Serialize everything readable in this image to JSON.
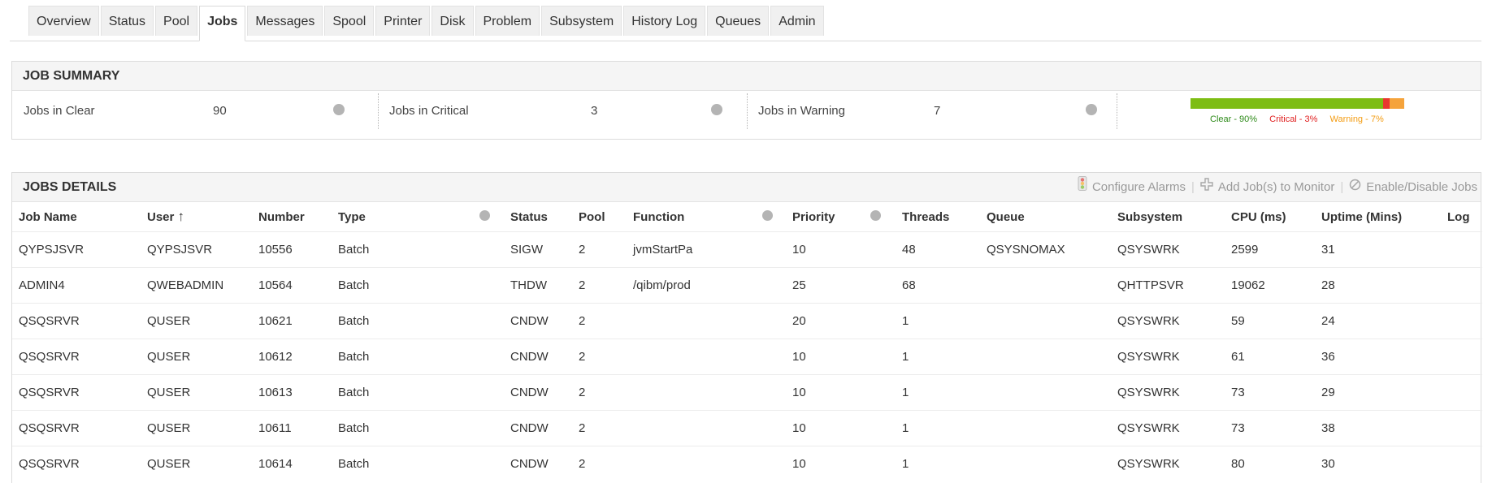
{
  "tabs": [
    {
      "label": "Overview",
      "active": false
    },
    {
      "label": "Status",
      "active": false
    },
    {
      "label": "Pool",
      "active": false
    },
    {
      "label": "Jobs",
      "active": true
    },
    {
      "label": "Messages",
      "active": false
    },
    {
      "label": "Spool",
      "active": false
    },
    {
      "label": "Printer",
      "active": false
    },
    {
      "label": "Disk",
      "active": false
    },
    {
      "label": "Problem",
      "active": false
    },
    {
      "label": "Subsystem",
      "active": false
    },
    {
      "label": "History Log",
      "active": false
    },
    {
      "label": "Queues",
      "active": false
    },
    {
      "label": "Admin",
      "active": false
    }
  ],
  "summary": {
    "title": "JOB SUMMARY",
    "clear": {
      "label": "Jobs in Clear",
      "value": "90"
    },
    "critical": {
      "label": "Jobs in Critical",
      "value": "3"
    },
    "warning": {
      "label": "Jobs in Warning",
      "value": "7"
    },
    "health": {
      "clear_pct": 90,
      "critical_pct": 3,
      "warning_pct": 7,
      "clear_label": "Clear - 90%",
      "critical_label": "Critical - 3%",
      "warning_label": "Warning - 7%",
      "colors": {
        "clear": "#7dbd13",
        "critical": "#e8382e",
        "warning": "#f5a33b"
      },
      "legend_colors": {
        "clear": "#2e8b1a",
        "critical": "#e02020",
        "warning": "#f39c12"
      }
    }
  },
  "details": {
    "title": "JOBS DETAILS",
    "actions": {
      "configure": "Configure Alarms",
      "add": "Add Job(s) to Monitor",
      "enable": "Enable/Disable Jobs"
    },
    "columns": {
      "job_name": "Job Name",
      "user": "User",
      "user_sort": "↑",
      "number": "Number",
      "type": "Type",
      "status": "Status",
      "pool": "Pool",
      "function": "Function",
      "priority": "Priority",
      "threads": "Threads",
      "queue": "Queue",
      "subsystem": "Subsystem",
      "cpu": "CPU (ms)",
      "uptime": "Uptime (Mins)",
      "log": "Log"
    },
    "rows": [
      {
        "job_name": "QYPSJSVR",
        "user": "QYPSJSVR",
        "number": "10556",
        "type": "Batch",
        "status": "SIGW",
        "pool": "2",
        "function": "jvmStartPa",
        "priority": "10",
        "threads": "48",
        "queue": "QSYSNOMAX",
        "subsystem": "QSYSWRK",
        "cpu": "2599",
        "uptime": "31",
        "log": ""
      },
      {
        "job_name": "ADMIN4",
        "user": "QWEBADMIN",
        "number": "10564",
        "type": "Batch",
        "status": "THDW",
        "pool": "2",
        "function": "/qibm/prod",
        "priority": "25",
        "threads": "68",
        "queue": "",
        "subsystem": "QHTTPSVR",
        "cpu": "19062",
        "uptime": "28",
        "log": ""
      },
      {
        "job_name": "QSQSRVR",
        "user": "QUSER",
        "number": "10621",
        "type": "Batch",
        "status": "CNDW",
        "pool": "2",
        "function": "",
        "priority": "20",
        "threads": "1",
        "queue": "",
        "subsystem": "QSYSWRK",
        "cpu": "59",
        "uptime": "24",
        "log": ""
      },
      {
        "job_name": "QSQSRVR",
        "user": "QUSER",
        "number": "10612",
        "type": "Batch",
        "status": "CNDW",
        "pool": "2",
        "function": "",
        "priority": "10",
        "threads": "1",
        "queue": "",
        "subsystem": "QSYSWRK",
        "cpu": "61",
        "uptime": "36",
        "log": ""
      },
      {
        "job_name": "QSQSRVR",
        "user": "QUSER",
        "number": "10613",
        "type": "Batch",
        "status": "CNDW",
        "pool": "2",
        "function": "",
        "priority": "10",
        "threads": "1",
        "queue": "",
        "subsystem": "QSYSWRK",
        "cpu": "73",
        "uptime": "29",
        "log": ""
      },
      {
        "job_name": "QSQSRVR",
        "user": "QUSER",
        "number": "10611",
        "type": "Batch",
        "status": "CNDW",
        "pool": "2",
        "function": "",
        "priority": "10",
        "threads": "1",
        "queue": "",
        "subsystem": "QSYSWRK",
        "cpu": "73",
        "uptime": "38",
        "log": ""
      },
      {
        "job_name": "QSQSRVR",
        "user": "QUSER",
        "number": "10614",
        "type": "Batch",
        "status": "CNDW",
        "pool": "2",
        "function": "",
        "priority": "10",
        "threads": "1",
        "queue": "",
        "subsystem": "QSYSWRK",
        "cpu": "80",
        "uptime": "30",
        "log": ""
      }
    ]
  }
}
